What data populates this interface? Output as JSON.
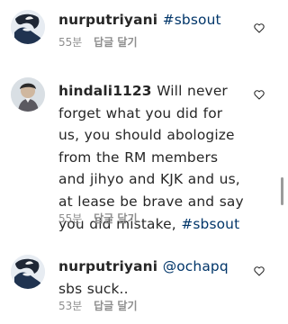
{
  "comments": [
    {
      "username": "nurputriyani",
      "mention": "",
      "text": "",
      "hashtag": "#sbsout",
      "time": "55분",
      "reply_label": "답글 달기",
      "like_icon": "heart-outline-icon"
    },
    {
      "username": "hindali1123",
      "mention": "",
      "text": "Will never forget what you did for us, you should abologize from the RM members and jihyo and KJK and us,  at lease be brave and say you did mistake,",
      "hashtag": "#sbsout",
      "time": "55분",
      "reply_label": "답글 달기",
      "like_icon": "heart-outline-icon"
    },
    {
      "username": "nurputriyani",
      "mention": "@ochapq",
      "text": "sbs suck..",
      "hashtag": "",
      "time": "53분",
      "reply_label": "답글 달기",
      "like_icon": "heart-outline-icon"
    }
  ],
  "colors": {
    "text": "#262626",
    "link": "#003569",
    "meta": "#8e8e8e"
  }
}
